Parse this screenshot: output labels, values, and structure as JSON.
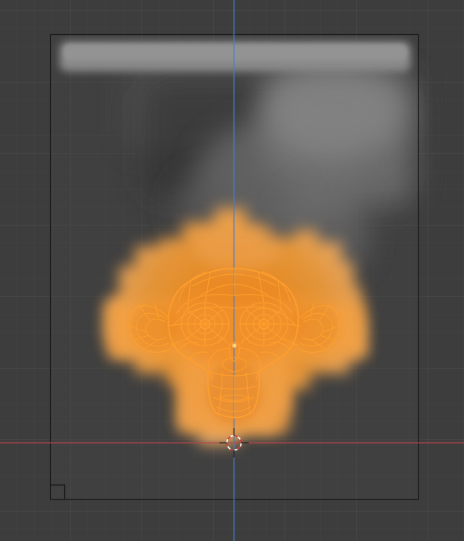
{
  "viewport": {
    "view": "front-orthographic",
    "background_color": "#3d3d3d",
    "grid_minor_color": "#444444",
    "grid_major_color": "#4c4c4c",
    "z_axis_color": "#4a7dc9",
    "x_axis_color": "#b8434d"
  },
  "domain_box": {
    "outline_color": "#1a1a1a",
    "corner_marker_color": "#111111"
  },
  "simulation": {
    "type": "fire-and-smoke",
    "smoke_color": "#8a8a8a",
    "fire_inner_color": "#ff9a2a",
    "fire_edge_color": "#e9a55a"
  },
  "mesh": {
    "object": "suzanne",
    "display": "wireframe",
    "wire_color": "#ff9f2e"
  },
  "cursor_3d": {
    "icon": "3d-cursor-icon",
    "ring_color_a": "#ffffff",
    "ring_color_b": "#d23b3b"
  }
}
